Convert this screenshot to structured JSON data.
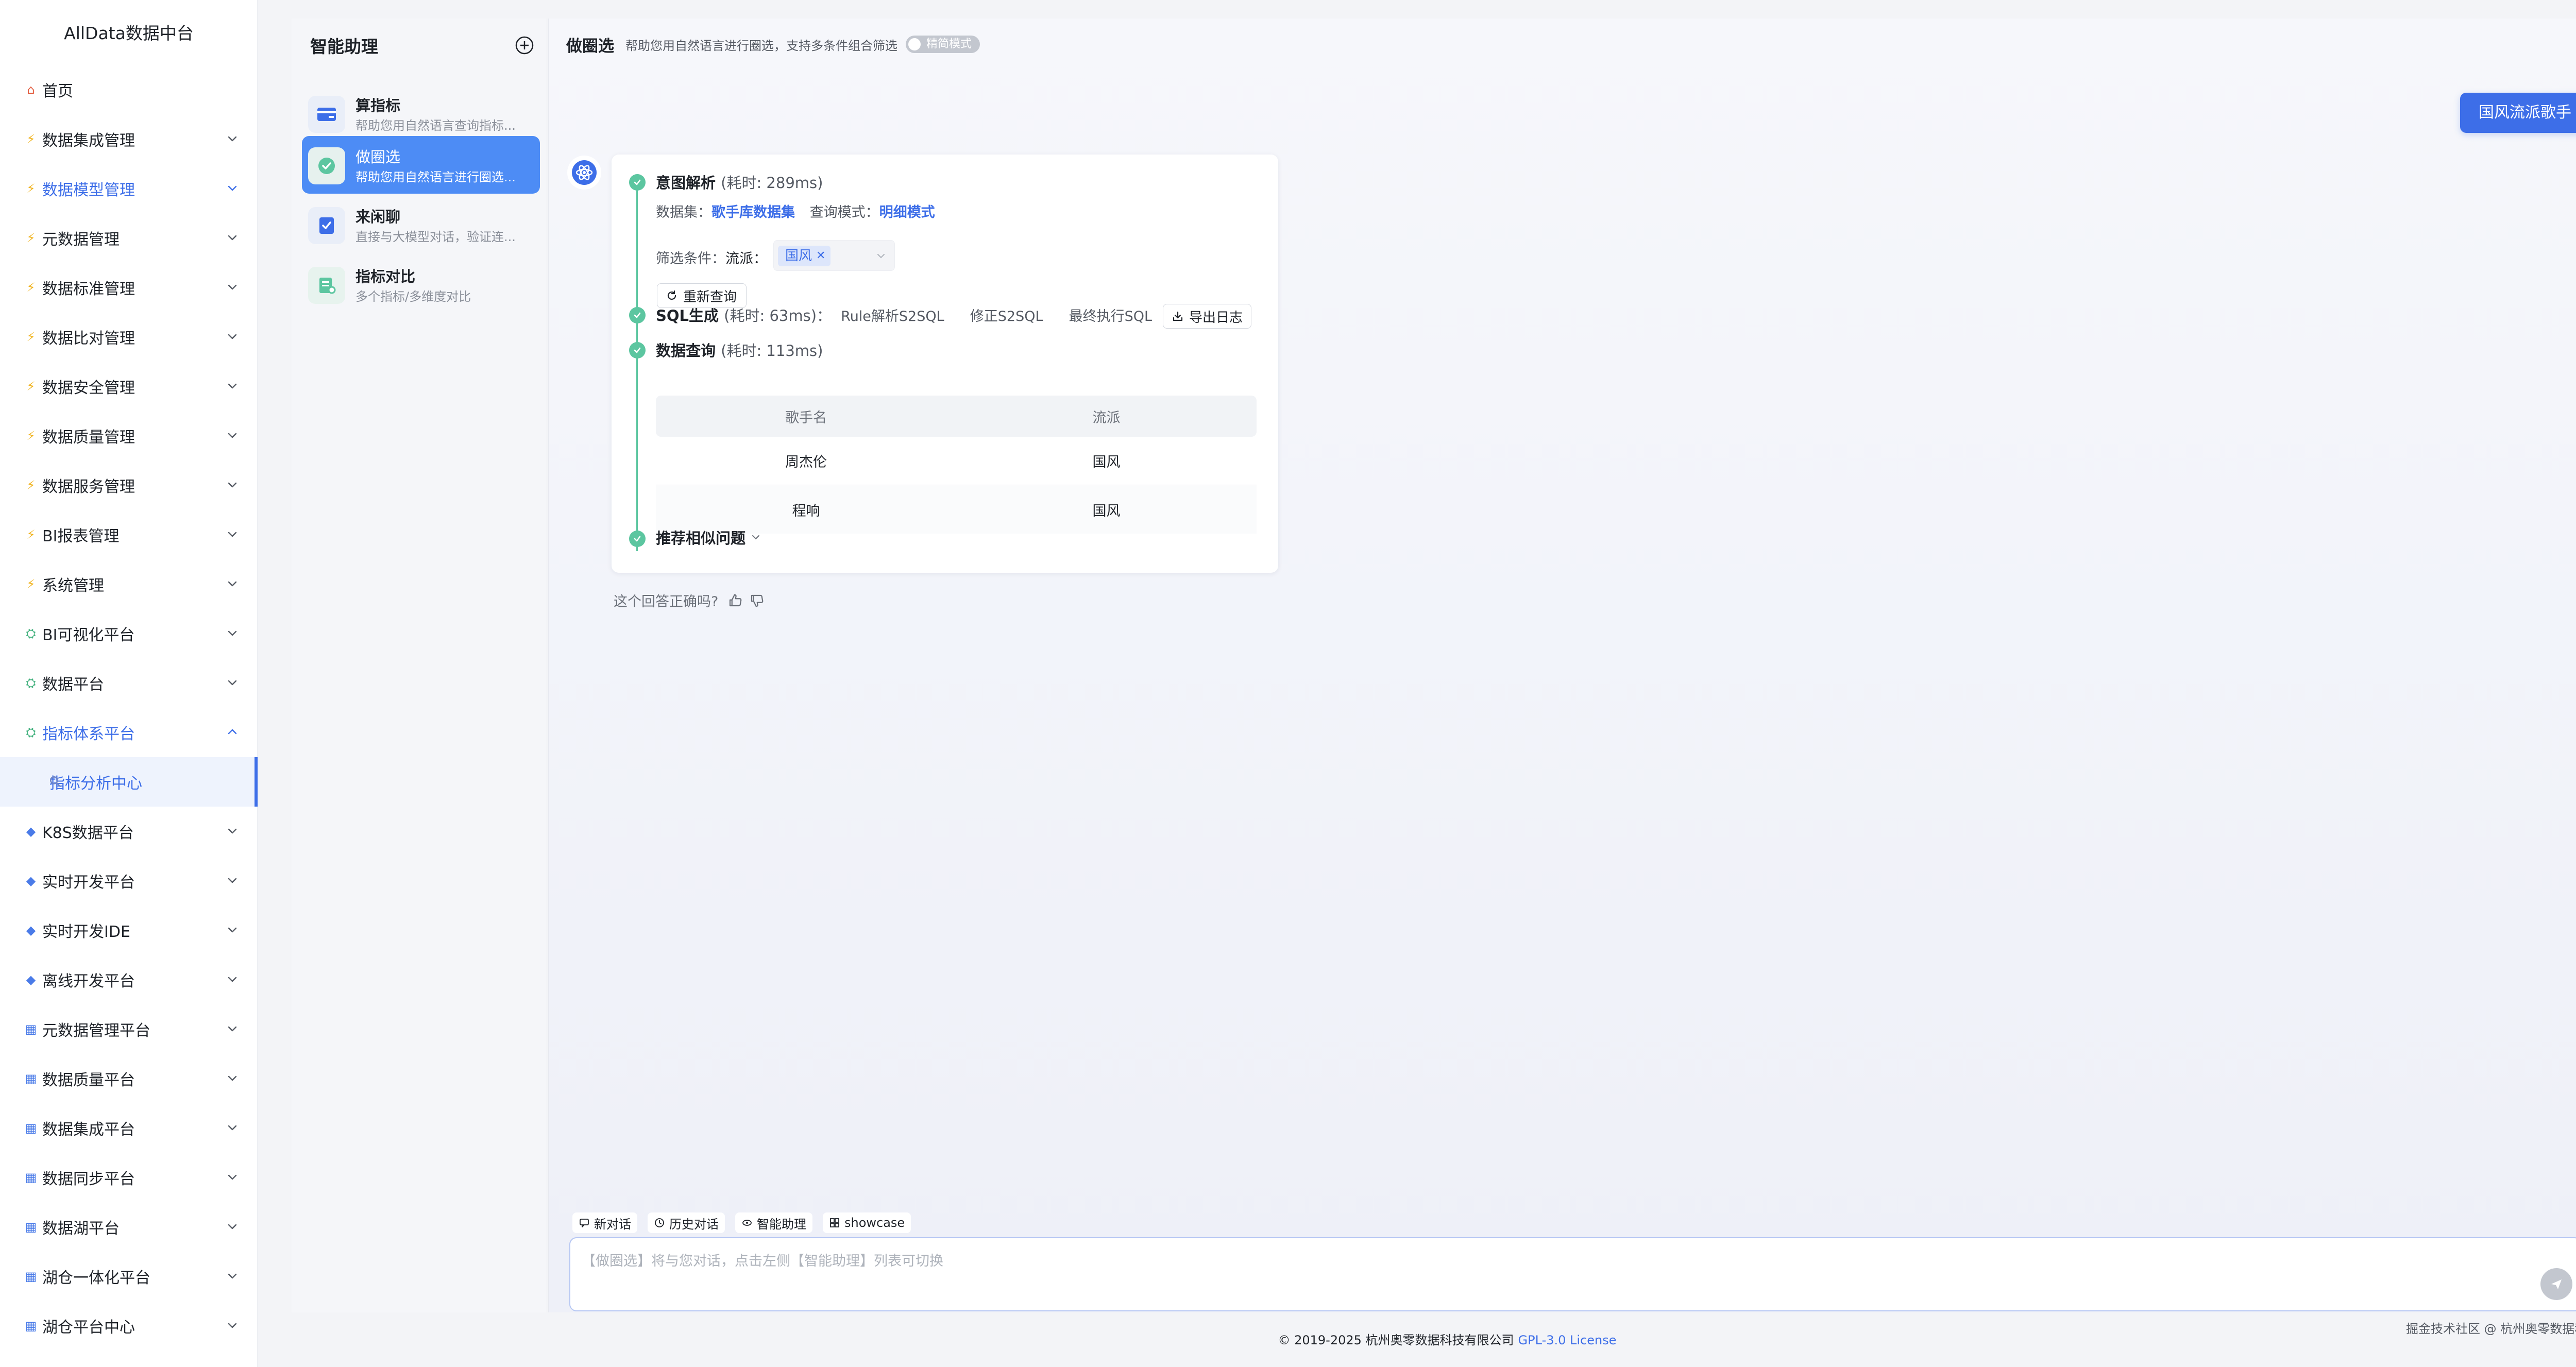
{
  "app": {
    "title": "AllData数据中台"
  },
  "sidebar": {
    "items": [
      {
        "label": "首页",
        "icon": "home-icon",
        "expandable": false
      },
      {
        "label": "数据集成管理",
        "icon": "lightning-icon",
        "expandable": true
      },
      {
        "label": "数据模型管理",
        "icon": "lightning-icon",
        "expandable": true,
        "active": true
      },
      {
        "label": "元数据管理",
        "icon": "lightning-icon",
        "expandable": true
      },
      {
        "label": "数据标准管理",
        "icon": "lightning-icon",
        "expandable": true
      },
      {
        "label": "数据比对管理",
        "icon": "lightning-icon",
        "expandable": true
      },
      {
        "label": "数据安全管理",
        "icon": "lightning-icon",
        "expandable": true
      },
      {
        "label": "数据质量管理",
        "icon": "lightning-icon",
        "expandable": true
      },
      {
        "label": "数据服务管理",
        "icon": "lightning-icon",
        "expandable": true
      },
      {
        "label": "BI报表管理",
        "icon": "lightning-icon",
        "expandable": true
      },
      {
        "label": "系统管理",
        "icon": "lightning-icon",
        "expandable": true
      },
      {
        "label": "BI可视化平台",
        "icon": "person-icon",
        "expandable": true
      },
      {
        "label": "数据平台",
        "icon": "person-icon",
        "expandable": true
      },
      {
        "label": "指标体系平台",
        "icon": "person-icon",
        "expandable": true,
        "expanded": true,
        "active": true
      },
      {
        "label": "K8S数据平台",
        "icon": "diamond-icon",
        "expandable": true
      },
      {
        "label": "实时开发平台",
        "icon": "diamond-icon",
        "expandable": true
      },
      {
        "label": "实时开发IDE",
        "icon": "diamond-icon",
        "expandable": true
      },
      {
        "label": "离线开发平台",
        "icon": "diamond-icon",
        "expandable": true
      },
      {
        "label": "元数据管理平台",
        "icon": "grid-icon",
        "expandable": true
      },
      {
        "label": "数据质量平台",
        "icon": "grid-icon",
        "expandable": true
      },
      {
        "label": "数据集成平台",
        "icon": "grid-icon",
        "expandable": true
      },
      {
        "label": "数据同步平台",
        "icon": "grid-icon",
        "expandable": true
      },
      {
        "label": "数据湖平台",
        "icon": "grid-icon",
        "expandable": true
      },
      {
        "label": "湖仓一体化平台",
        "icon": "grid-icon",
        "expandable": true
      },
      {
        "label": "湖仓平台中心",
        "icon": "grid-icon",
        "expandable": true
      }
    ],
    "sub_item": {
      "label": "指标分析中心",
      "icon": "magnifier-icon"
    }
  },
  "assistant_panel": {
    "title": "智能助理",
    "items": [
      {
        "title": "算指标",
        "desc": "帮助您用自然语言查询指标...",
        "icon": "card-icon",
        "active": false
      },
      {
        "title": "做圈选",
        "desc": "帮助您用自然语言进行圈选...",
        "icon": "check-badge-icon",
        "active": true
      },
      {
        "title": "来闲聊",
        "desc": "直接与大模型对话，验证连...",
        "icon": "chat-doc-icon",
        "active": false
      },
      {
        "title": "指标对比",
        "desc": "多个指标/多维度对比",
        "icon": "compare-icon",
        "active": false
      }
    ]
  },
  "chat": {
    "header": {
      "title": "做圈选",
      "desc": "帮助您用自然语言进行圈选，支持多条件组合筛选",
      "mode_toggle": "精简模式"
    },
    "user_message": "国风流派歌手",
    "answer": {
      "intent": {
        "title": "意图解析",
        "cost": "(耗时: 289ms)",
        "dataset_label": "数据集：",
        "dataset_value": "歌手库数据集",
        "mode_label": "查询模式：",
        "mode_value": "明细模式",
        "filter_label": "筛选条件：",
        "filter_key": "流派：",
        "filter_tag": "国风",
        "requery": "重新查询"
      },
      "sql": {
        "title": "SQL生成",
        "cost": "(耗时: 63ms)：",
        "links": [
          "Rule解析S2SQL",
          "修正S2SQL",
          "最终执行SQL"
        ],
        "export": "导出日志"
      },
      "query": {
        "title": "数据查询",
        "cost": "(耗时: 113ms)",
        "columns": [
          "歌手名",
          "流派"
        ],
        "rows": [
          [
            "周杰伦",
            "国风"
          ],
          [
            "程响",
            "国风"
          ]
        ]
      },
      "similar": {
        "title": "推荐相似问题"
      }
    },
    "feedback": {
      "question": "这个回答正确吗?"
    },
    "toolbar": {
      "new_chat": "新对话",
      "history": "历史对话",
      "assistant": "智能助理",
      "showcase": "showcase"
    },
    "input": {
      "placeholder": "【做圈选】将与您对话，点击左侧【智能助理】列表可切换"
    }
  },
  "footer": {
    "copyright": "© 2019-2025 杭州奥零数据科技有限公司",
    "license": "GPL-3.0 License",
    "corner": "掘金技术社区 @ 杭州奥零数据科技"
  },
  "colors": {
    "accent": "#3d6ee8",
    "success": "#5cc6a0",
    "active_assistant": "#4d8cf5"
  }
}
